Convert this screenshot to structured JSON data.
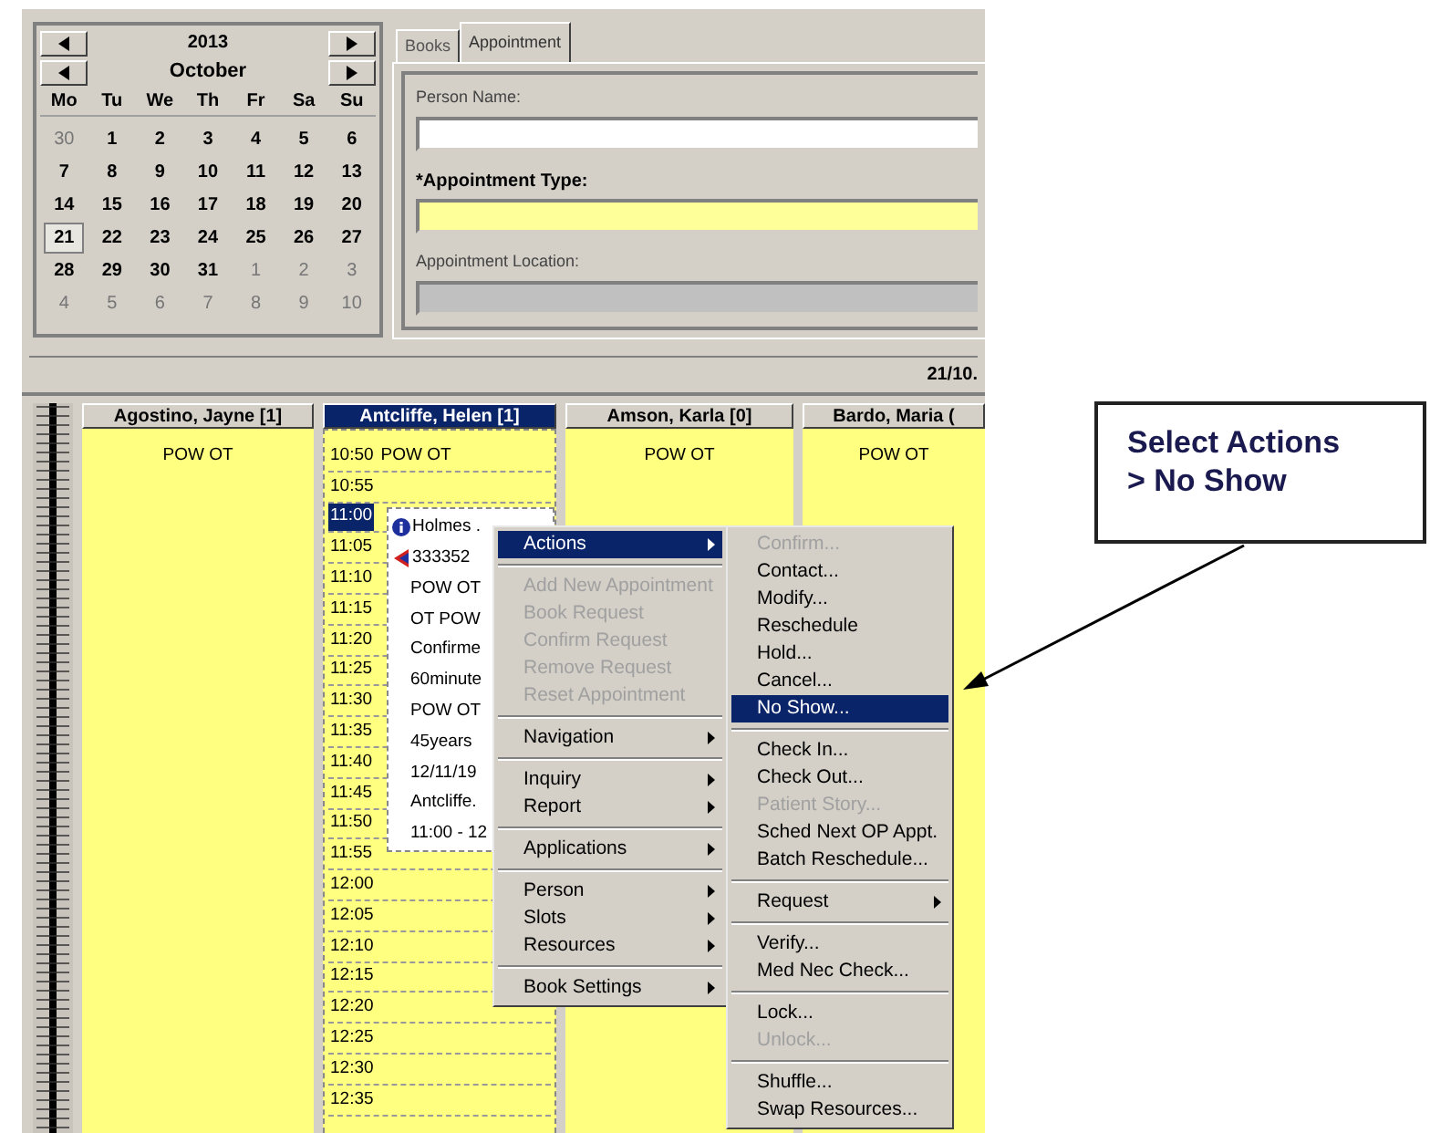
{
  "calendar": {
    "year": "2013",
    "month": "October",
    "weekdays": [
      "Mo",
      "Tu",
      "We",
      "Th",
      "Fr",
      "Sa",
      "Su"
    ],
    "weeks": [
      [
        {
          "day": "30",
          "other_month": true,
          "selected": false
        },
        {
          "day": "1",
          "other_month": false,
          "selected": false
        },
        {
          "day": "2",
          "other_month": false,
          "selected": false
        },
        {
          "day": "3",
          "other_month": false,
          "selected": false
        },
        {
          "day": "4",
          "other_month": false,
          "selected": false
        },
        {
          "day": "5",
          "other_month": false,
          "selected": false
        },
        {
          "day": "6",
          "other_month": false,
          "selected": false
        }
      ],
      [
        {
          "day": "7",
          "other_month": false,
          "selected": false
        },
        {
          "day": "8",
          "other_month": false,
          "selected": false
        },
        {
          "day": "9",
          "other_month": false,
          "selected": false
        },
        {
          "day": "10",
          "other_month": false,
          "selected": false
        },
        {
          "day": "11",
          "other_month": false,
          "selected": false
        },
        {
          "day": "12",
          "other_month": false,
          "selected": false
        },
        {
          "day": "13",
          "other_month": false,
          "selected": false
        }
      ],
      [
        {
          "day": "14",
          "other_month": false,
          "selected": false
        },
        {
          "day": "15",
          "other_month": false,
          "selected": false
        },
        {
          "day": "16",
          "other_month": false,
          "selected": false
        },
        {
          "day": "17",
          "other_month": false,
          "selected": false
        },
        {
          "day": "18",
          "other_month": false,
          "selected": false
        },
        {
          "day": "19",
          "other_month": false,
          "selected": false
        },
        {
          "day": "20",
          "other_month": false,
          "selected": false
        }
      ],
      [
        {
          "day": "21",
          "other_month": false,
          "selected": true
        },
        {
          "day": "22",
          "other_month": false,
          "selected": false
        },
        {
          "day": "23",
          "other_month": false,
          "selected": false
        },
        {
          "day": "24",
          "other_month": false,
          "selected": false
        },
        {
          "day": "25",
          "other_month": false,
          "selected": false
        },
        {
          "day": "26",
          "other_month": false,
          "selected": false
        },
        {
          "day": "27",
          "other_month": false,
          "selected": false
        }
      ],
      [
        {
          "day": "28",
          "other_month": false,
          "selected": false
        },
        {
          "day": "29",
          "other_month": false,
          "selected": false
        },
        {
          "day": "30",
          "other_month": false,
          "selected": false
        },
        {
          "day": "31",
          "other_month": false,
          "selected": false
        },
        {
          "day": "1",
          "other_month": true,
          "selected": false
        },
        {
          "day": "2",
          "other_month": true,
          "selected": false
        },
        {
          "day": "3",
          "other_month": true,
          "selected": false
        }
      ],
      [
        {
          "day": "4",
          "other_month": true,
          "selected": false
        },
        {
          "day": "5",
          "other_month": true,
          "selected": false
        },
        {
          "day": "6",
          "other_month": true,
          "selected": false
        },
        {
          "day": "7",
          "other_month": true,
          "selected": false
        },
        {
          "day": "8",
          "other_month": true,
          "selected": false
        },
        {
          "day": "9",
          "other_month": true,
          "selected": false
        },
        {
          "day": "10",
          "other_month": true,
          "selected": false
        }
      ]
    ]
  },
  "tabs": [
    {
      "label": "Books",
      "selected": false
    },
    {
      "label": "Appointment",
      "selected": true
    }
  ],
  "fields": [
    {
      "label": "Person Name:",
      "kind": "normal"
    },
    {
      "label": "*Appointment Type:",
      "kind": "required"
    },
    {
      "label": "Appointment Location:",
      "kind": "disabled"
    }
  ],
  "date_bar": "21/10.",
  "columns": [
    {
      "name": "Agostino, Jayne [1]",
      "selected": false,
      "kind": "block",
      "label": "POW OT"
    },
    {
      "name": "Antcliffe, Helen [1]",
      "selected": true,
      "kind": "slots",
      "slots": [
        {
          "time": "10:50",
          "text": "POW OT",
          "selected": false
        },
        {
          "time": "10:55",
          "selected": false
        },
        {
          "time": "11:00",
          "selected": true
        },
        {
          "time": "11:05",
          "selected": false
        },
        {
          "time": "11:10",
          "selected": false
        },
        {
          "time": "11:15",
          "selected": false
        },
        {
          "time": "11:20",
          "selected": false
        },
        {
          "time": "11:25",
          "selected": false
        },
        {
          "time": "11:30",
          "selected": false
        },
        {
          "time": "11:35",
          "selected": false
        },
        {
          "time": "11:40",
          "selected": false
        },
        {
          "time": "11:45",
          "selected": false
        },
        {
          "time": "11:50",
          "selected": false
        },
        {
          "time": "11:55",
          "selected": false
        },
        {
          "time": "12:00",
          "selected": false
        },
        {
          "time": "12:05",
          "selected": false
        },
        {
          "time": "12:10",
          "selected": false
        },
        {
          "time": "12:15",
          "selected": false
        },
        {
          "time": "12:20",
          "selected": false
        },
        {
          "time": "12:25",
          "selected": false
        },
        {
          "time": "12:30",
          "selected": false
        },
        {
          "time": "12:35",
          "selected": false
        }
      ]
    },
    {
      "name": "Amson, Karla [0]",
      "selected": false,
      "kind": "block",
      "label": "POW OT"
    },
    {
      "name": "Bardo, Maria (",
      "selected": false,
      "kind": "block",
      "label": "POW OT"
    }
  ],
  "appointment_popup": {
    "lines": [
      {
        "text": "Holmes .",
        "kind": "info"
      },
      {
        "text": "333352",
        "kind": "flag"
      },
      {
        "text": "POW OT",
        "kind": "plain"
      },
      {
        "text": "OT POW",
        "kind": "plain"
      },
      {
        "text": "Confirme",
        "kind": "plain"
      },
      {
        "text": "60minute",
        "kind": "plain"
      },
      {
        "text": "POW OT",
        "kind": "plain"
      },
      {
        "text": "45years",
        "kind": "plain"
      },
      {
        "text": "12/11/19",
        "kind": "plain"
      },
      {
        "text": "Antcliffe.",
        "kind": "plain"
      },
      {
        "text": "11:00 - 12",
        "kind": "plain"
      }
    ]
  },
  "context_menu": [
    {
      "kind": "item",
      "label": "Actions",
      "submenu": true,
      "selected": true,
      "disabled": false
    },
    {
      "kind": "separator"
    },
    {
      "kind": "item",
      "label": "Add New Appointment",
      "submenu": false,
      "selected": false,
      "disabled": true
    },
    {
      "kind": "item",
      "label": "Book Request",
      "submenu": false,
      "selected": false,
      "disabled": true
    },
    {
      "kind": "item",
      "label": "Confirm Request",
      "submenu": false,
      "selected": false,
      "disabled": true
    },
    {
      "kind": "item",
      "label": "Remove Request",
      "submenu": false,
      "selected": false,
      "disabled": true
    },
    {
      "kind": "item",
      "label": "Reset Appointment",
      "submenu": false,
      "selected": false,
      "disabled": true
    },
    {
      "kind": "separator"
    },
    {
      "kind": "item",
      "label": "Navigation",
      "submenu": true,
      "selected": false,
      "disabled": false
    },
    {
      "kind": "separator"
    },
    {
      "kind": "item",
      "label": "Inquiry",
      "submenu": true,
      "selected": false,
      "disabled": false
    },
    {
      "kind": "item",
      "label": "Report",
      "submenu": true,
      "selected": false,
      "disabled": false
    },
    {
      "kind": "separator"
    },
    {
      "kind": "item",
      "label": "Applications",
      "submenu": true,
      "selected": false,
      "disabled": false
    },
    {
      "kind": "separator"
    },
    {
      "kind": "item",
      "label": "Person",
      "submenu": true,
      "selected": false,
      "disabled": false
    },
    {
      "kind": "item",
      "label": "Slots",
      "submenu": true,
      "selected": false,
      "disabled": false
    },
    {
      "kind": "item",
      "label": "Resources",
      "submenu": true,
      "selected": false,
      "disabled": false
    },
    {
      "kind": "separator"
    },
    {
      "kind": "item",
      "label": "Book Settings",
      "submenu": true,
      "selected": false,
      "disabled": false
    }
  ],
  "actions_submenu": [
    {
      "kind": "item",
      "label": "Confirm...",
      "submenu": false,
      "selected": false,
      "disabled": true
    },
    {
      "kind": "item",
      "label": "Contact...",
      "submenu": false,
      "selected": false,
      "disabled": false
    },
    {
      "kind": "item",
      "label": "Modify...",
      "submenu": false,
      "selected": false,
      "disabled": false
    },
    {
      "kind": "item",
      "label": "Reschedule",
      "submenu": false,
      "selected": false,
      "disabled": false
    },
    {
      "kind": "item",
      "label": "Hold...",
      "submenu": false,
      "selected": false,
      "disabled": false
    },
    {
      "kind": "item",
      "label": "Cancel...",
      "submenu": false,
      "selected": false,
      "disabled": false
    },
    {
      "kind": "item",
      "label": "No Show...",
      "submenu": false,
      "selected": true,
      "disabled": false
    },
    {
      "kind": "separator"
    },
    {
      "kind": "item",
      "label": "Check In...",
      "submenu": false,
      "selected": false,
      "disabled": false
    },
    {
      "kind": "item",
      "label": "Check Out...",
      "submenu": false,
      "selected": false,
      "disabled": false
    },
    {
      "kind": "item",
      "label": "Patient Story...",
      "submenu": false,
      "selected": false,
      "disabled": true
    },
    {
      "kind": "item",
      "label": "Sched Next OP Appt.",
      "submenu": false,
      "selected": false,
      "disabled": false
    },
    {
      "kind": "item",
      "label": "Batch Reschedule...",
      "submenu": false,
      "selected": false,
      "disabled": false
    },
    {
      "kind": "separator"
    },
    {
      "kind": "item",
      "label": "Request",
      "submenu": true,
      "selected": false,
      "disabled": false
    },
    {
      "kind": "separator"
    },
    {
      "kind": "item",
      "label": "Verify...",
      "submenu": false,
      "selected": false,
      "disabled": false
    },
    {
      "kind": "item",
      "label": "Med Nec Check...",
      "submenu": false,
      "selected": false,
      "disabled": false
    },
    {
      "kind": "separator"
    },
    {
      "kind": "item",
      "label": "Lock...",
      "submenu": false,
      "selected": false,
      "disabled": false
    },
    {
      "kind": "item",
      "label": "Unlock...",
      "submenu": false,
      "selected": false,
      "disabled": true
    },
    {
      "kind": "separator"
    },
    {
      "kind": "item",
      "label": "Shuffle...",
      "submenu": false,
      "selected": false,
      "disabled": false
    },
    {
      "kind": "item",
      "label": "Swap Resources...",
      "submenu": false,
      "selected": false,
      "disabled": false
    }
  ],
  "callout": {
    "lines": [
      "Select Actions",
      "> No Show"
    ]
  }
}
